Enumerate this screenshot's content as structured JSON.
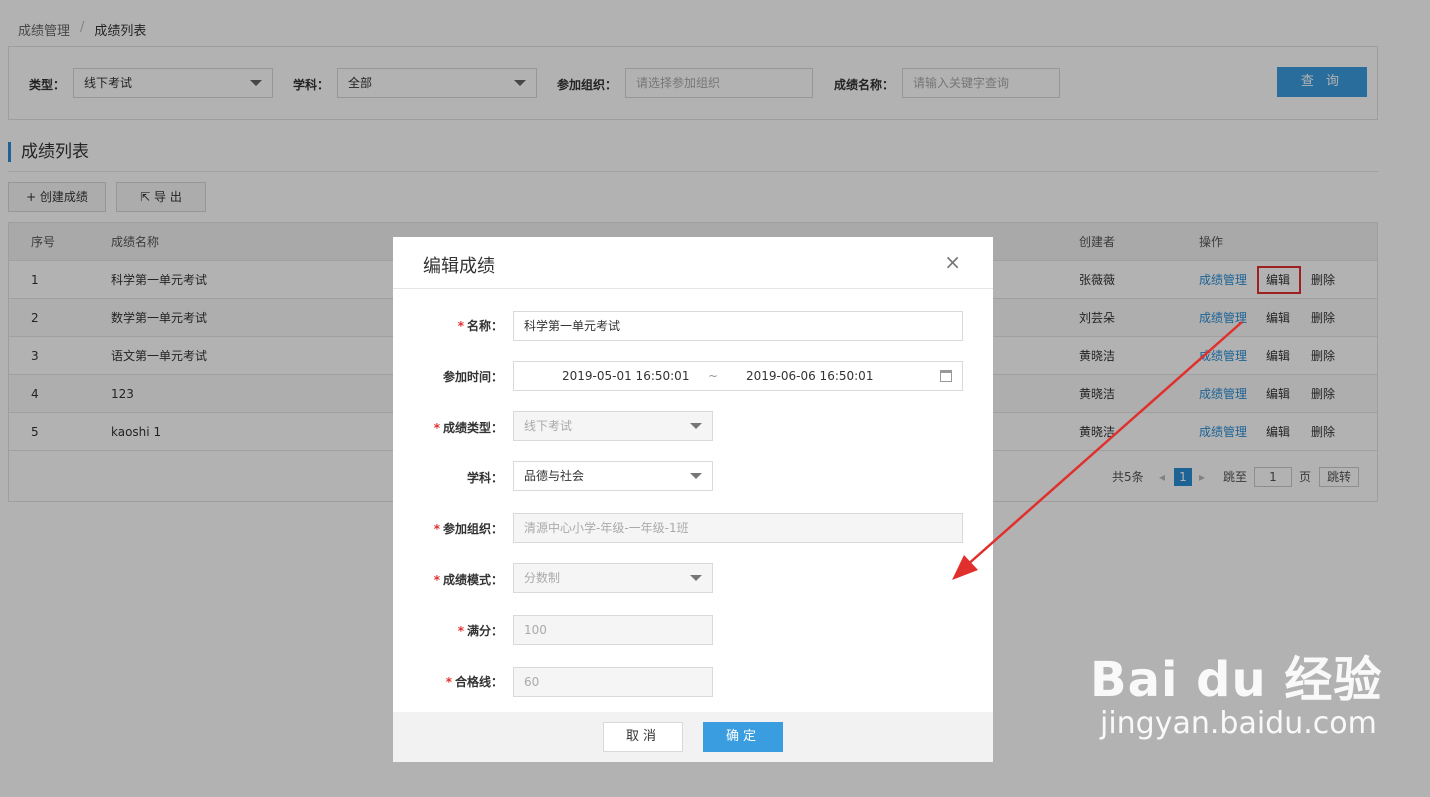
{
  "breadcrumb": {
    "parent": "成绩管理",
    "separator": "/",
    "current": "成绩列表"
  },
  "filters": {
    "type_label": "类型：",
    "type_value": "线下考试",
    "subject_label": "学科：",
    "subject_value": "全部",
    "org_label": "参加组织：",
    "org_placeholder": "请选择参加组织",
    "name_label": "成绩名称：",
    "name_placeholder": "请输入关键字查询",
    "query_button": "查 询"
  },
  "section_title": "成绩列表",
  "toolbar": {
    "create_label": "+ 创建成绩",
    "export_label": "导 出"
  },
  "table": {
    "columns": [
      "序号",
      "成绩名称",
      "创建者",
      "操作"
    ],
    "rows": [
      {
        "index": "1",
        "name": "科学第一单元考试",
        "creator": "张薇薇"
      },
      {
        "index": "2",
        "name": "数学第一单元考试",
        "creator": "刘芸朵"
      },
      {
        "index": "3",
        "name": "语文第一单元考试",
        "creator": "黄晓洁"
      },
      {
        "index": "4",
        "name": "123",
        "creator": "黄晓洁"
      },
      {
        "index": "5",
        "name": "kaoshi 1",
        "creator": "黄晓洁"
      }
    ],
    "actions": {
      "manage": "成绩管理",
      "edit": "编辑",
      "delete": "删除"
    }
  },
  "pager": {
    "total": "共5条",
    "current_page": "1",
    "goto": "跳至",
    "page_input": "1",
    "page_unit": "页",
    "jump_button": "跳转"
  },
  "modal": {
    "title": "编辑成绩",
    "close": "×",
    "required_mark": "*",
    "name_label": "名称：",
    "name_value": "科学第一单元考试",
    "time_label": "参加时间：",
    "time_start": "2019-05-01 16:50:01",
    "time_sep": "~",
    "time_end": "2019-06-06 16:50:01",
    "type_label": "成绩类型：",
    "type_value": "线下考试",
    "subject_label": "学科：",
    "subject_value": "品德与社会",
    "org_label": "参加组织：",
    "org_value": "清源中心小学-年级-一年级-1班",
    "mode_label": "成绩模式：",
    "mode_value": "分数制",
    "full_label": "满分：",
    "full_value": "100",
    "pass_label": "合格线：",
    "pass_value": "60",
    "cancel": "取消",
    "ok": "确定"
  },
  "watermark": {
    "logo": "Bai du 经验",
    "url": "jingyan.baidu.com"
  },
  "colors": {
    "accent": "#3a9de0",
    "link": "#2a8fd6",
    "required": "#e0302e",
    "annotation": "#e0302e"
  }
}
